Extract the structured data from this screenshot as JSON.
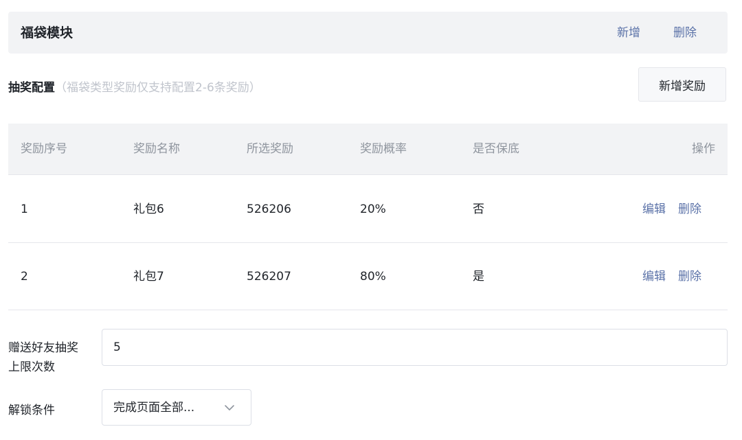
{
  "module": {
    "title": "福袋模块",
    "add_label": "新增",
    "delete_label": "删除"
  },
  "config": {
    "title": "抽奖配置",
    "hint": "（福袋类型奖励仅支持配置2-6条奖励）",
    "add_reward_label": "新增奖励"
  },
  "table": {
    "headers": [
      "奖励序号",
      "奖励名称",
      "所选奖励",
      "奖励概率",
      "是否保底",
      "操作"
    ],
    "rows": [
      {
        "index": "1",
        "name": "礼包6",
        "reward": "526206",
        "probability": "20%",
        "guaranteed": "否",
        "edit": "编辑",
        "delete": "删除"
      },
      {
        "index": "2",
        "name": "礼包7",
        "reward": "526207",
        "probability": "80%",
        "guaranteed": "是",
        "edit": "编辑",
        "delete": "删除"
      }
    ]
  },
  "form": {
    "limit_label": "赠送好友抽奖上限次数",
    "limit_value": "5",
    "unlock_label": "解锁条件",
    "unlock_value": "完成页面全部..."
  },
  "icons": {
    "select_arrow": "chevron-down-icon"
  },
  "colors": {
    "link": "#5b72a8",
    "header_bg": "#f2f3f5",
    "hint": "#c0c4cc"
  }
}
